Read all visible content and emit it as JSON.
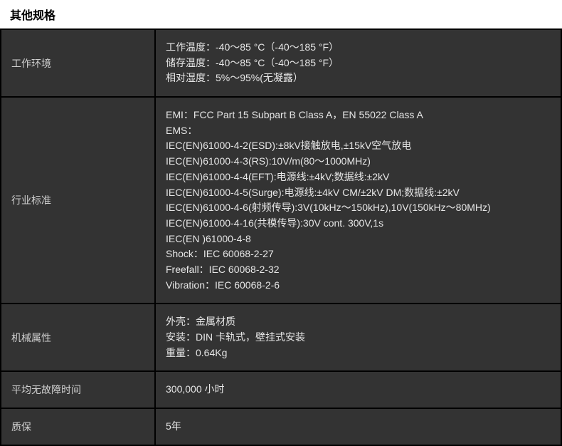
{
  "title": "其他规格",
  "rows": [
    {
      "label": "工作环境",
      "lines": [
        "工作温度：-40～85 °C（-40～185 °F）",
        "储存温度：-40～85 °C（-40～185 °F）",
        "相对湿度：5%～95%(无凝露）"
      ]
    },
    {
      "label": "行业标准",
      "lines": [
        "EMI：FCC Part 15 Subpart B Class A，EN 55022 Class A",
        "EMS：",
        "IEC(EN)61000-4-2(ESD):±8kV接触放电,±15kV空气放电",
        "IEC(EN)61000-4-3(RS):10V/m(80～1000MHz)",
        "IEC(EN)61000-4-4(EFT):电源线:±4kV;数据线:±2kV",
        "IEC(EN)61000-4-5(Surge):电源线:±4kV CM/±2kV DM;数据线:±2kV",
        "IEC(EN)61000-4-6(射频传导):3V(10kHz～150kHz),10V(150kHz～80MHz)",
        "IEC(EN)61000-4-16(共模传导):30V cont. 300V,1s",
        "IEC(EN )61000-4-8",
        "Shock：IEC 60068-2-27",
        "Freefall：IEC 60068-2-32",
        "Vibration：IEC 60068-2-6"
      ]
    },
    {
      "label": "机械属性",
      "lines": [
        "外壳：金属材质",
        "安装：DIN 卡轨式，壁挂式安装",
        "重量：0.64Kg"
      ]
    },
    {
      "label": "平均无故障时间",
      "lines": [
        "300,000 小时"
      ]
    },
    {
      "label": "质保",
      "lines": [
        "5年"
      ]
    }
  ]
}
